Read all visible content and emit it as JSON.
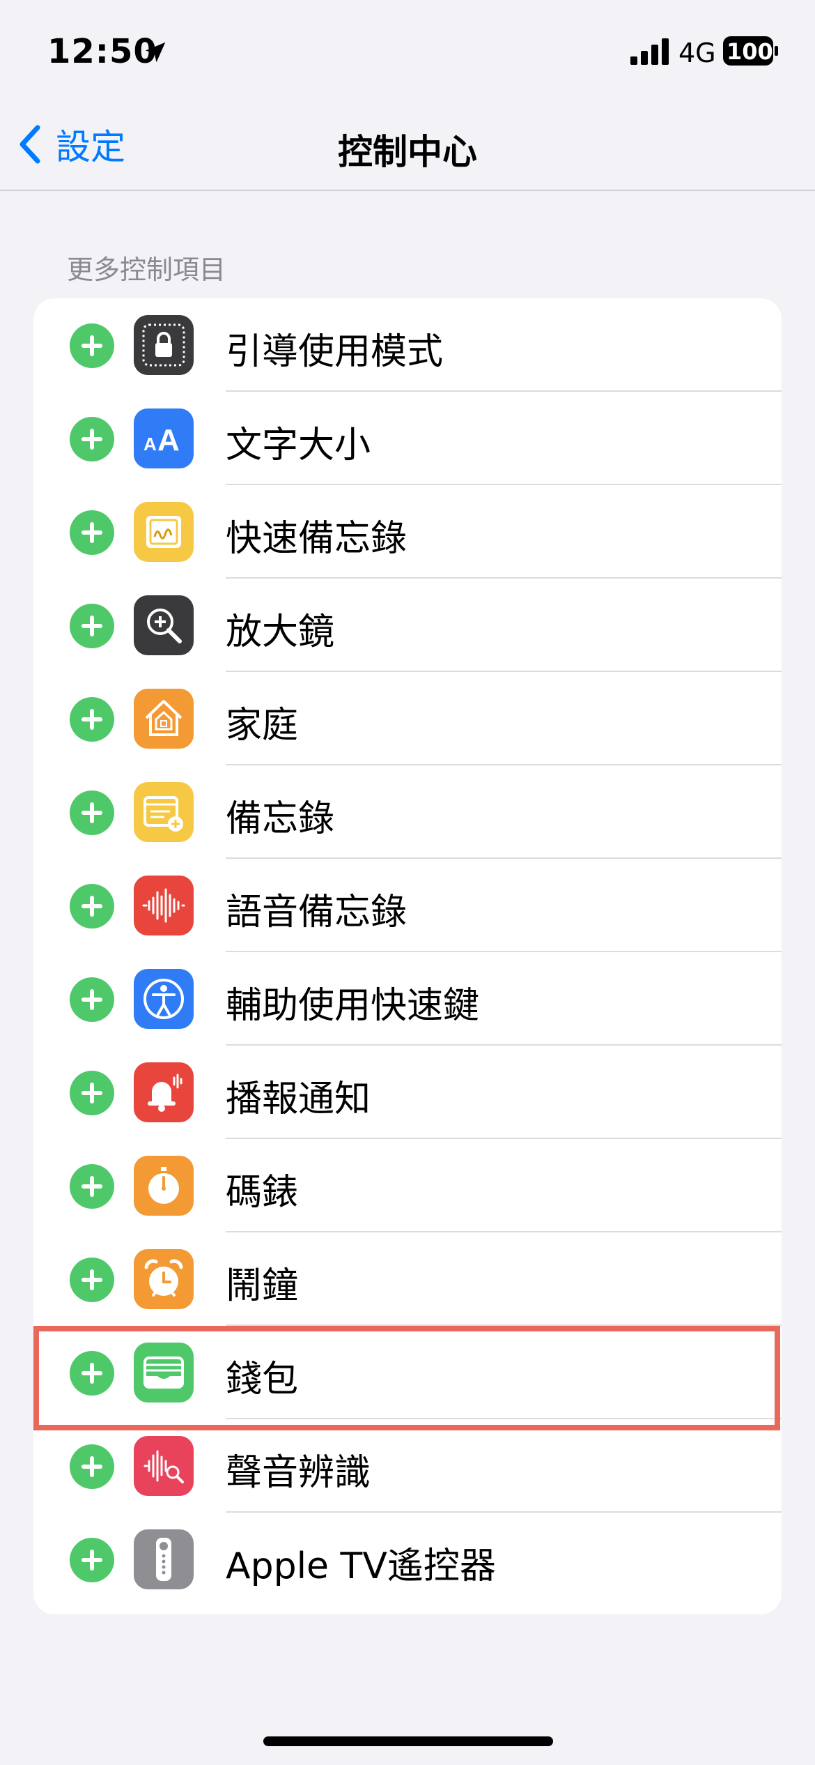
{
  "status": {
    "time": "12:50",
    "network": "4G",
    "battery": "100"
  },
  "nav": {
    "back_label": "設定",
    "title": "控制中心"
  },
  "section": {
    "header": "更多控制項目"
  },
  "colors": {
    "accent": "#007aff",
    "add_button": "#4fc86a",
    "highlight": "#e8685a"
  },
  "items": [
    {
      "label": "引導使用模式",
      "icon": "guided-access-icon",
      "color": "#3a3a3c"
    },
    {
      "label": "文字大小",
      "icon": "text-size-icon",
      "color": "#2f7cf6"
    },
    {
      "label": "快速備忘錄",
      "icon": "quick-note-icon",
      "color": "#f6c843"
    },
    {
      "label": "放大鏡",
      "icon": "magnifier-icon",
      "color": "#3a3a3c"
    },
    {
      "label": "家庭",
      "icon": "home-icon",
      "color": "#f39a35"
    },
    {
      "label": "備忘錄",
      "icon": "notes-icon",
      "color": "#f6c843"
    },
    {
      "label": "語音備忘錄",
      "icon": "voice-memos-icon",
      "color": "#e8453c"
    },
    {
      "label": "輔助使用快速鍵",
      "icon": "accessibility-icon",
      "color": "#2f7cf6"
    },
    {
      "label": "播報通知",
      "icon": "announce-notifications-icon",
      "color": "#e8453c"
    },
    {
      "label": "碼錶",
      "icon": "stopwatch-icon",
      "color": "#f39a35"
    },
    {
      "label": "鬧鐘",
      "icon": "alarm-icon",
      "color": "#f39a35"
    },
    {
      "label": "錢包",
      "icon": "wallet-icon",
      "color": "#4fc86a"
    },
    {
      "label": "聲音辨識",
      "icon": "sound-recognition-icon",
      "color": "#e8435a"
    },
    {
      "label": "Apple TV遙控器",
      "icon": "apple-tv-remote-icon",
      "color": "#8e8e93"
    }
  ]
}
